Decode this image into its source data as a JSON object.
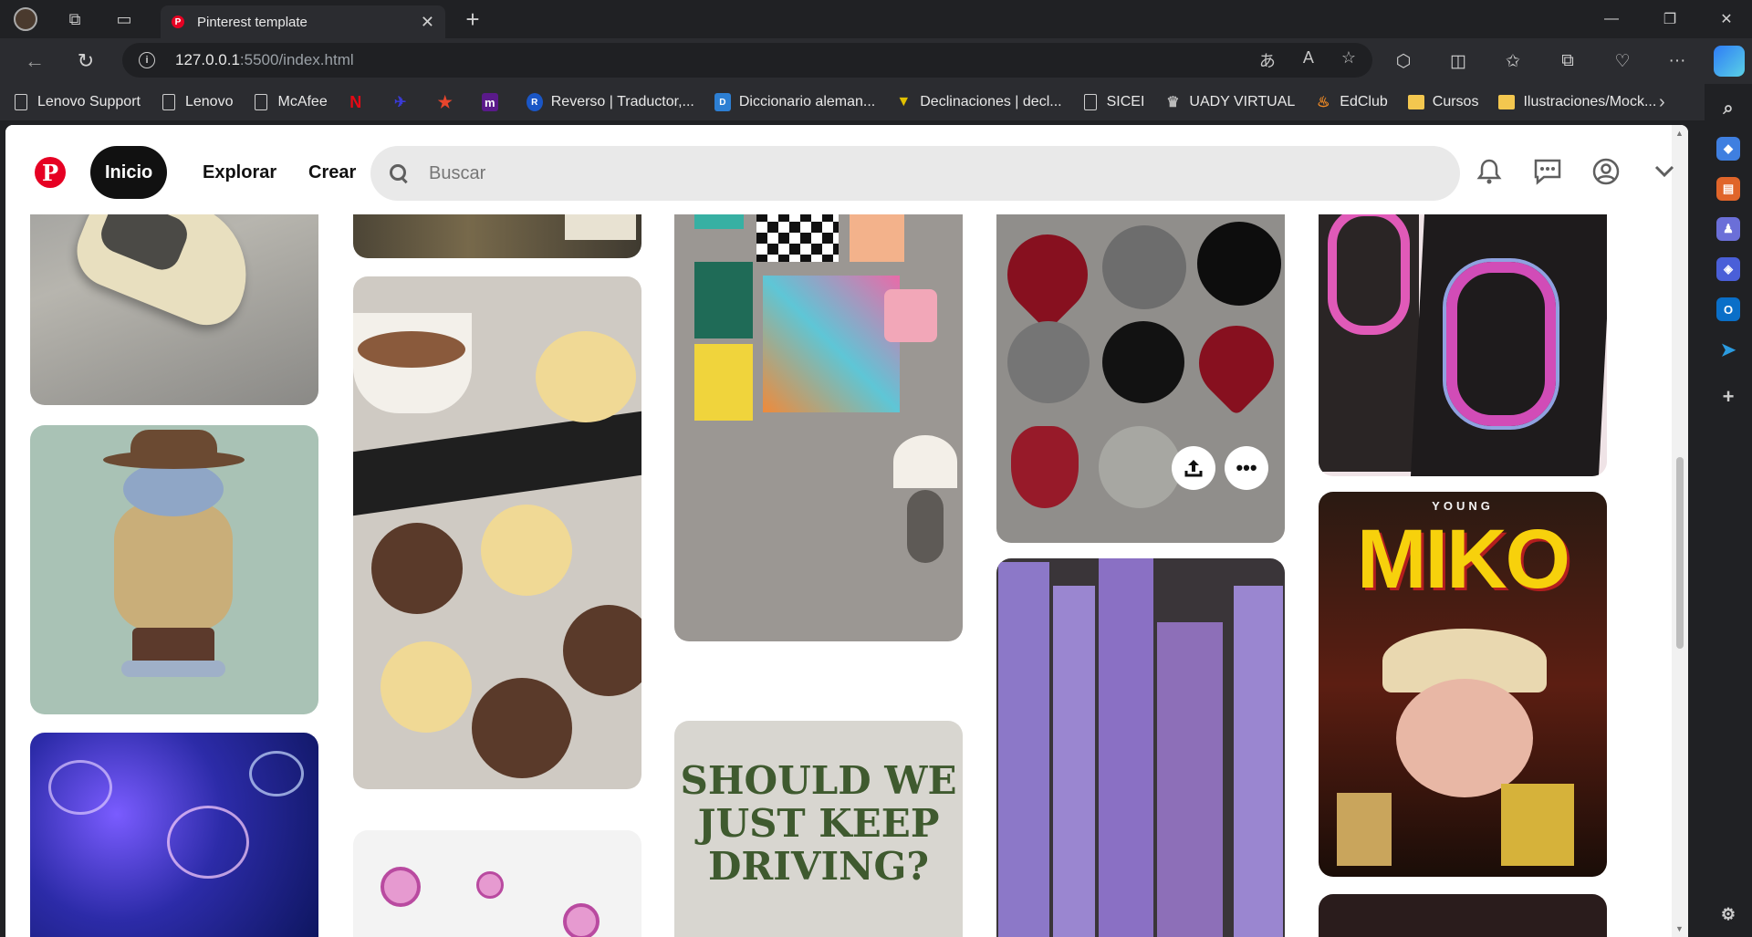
{
  "browser": {
    "tab_title": "Pinterest template",
    "url_host": "127.0.0.1",
    "url_rest": ":5500/index.html",
    "bookmarks": [
      {
        "label": "Lenovo Support",
        "icon": "doc-icon"
      },
      {
        "label": "Lenovo",
        "icon": "doc-icon"
      },
      {
        "label": "McAfee",
        "icon": "doc-icon"
      },
      {
        "label": "",
        "icon": "netflix-icon"
      },
      {
        "label": "",
        "icon": "bookmark-icon"
      },
      {
        "label": "",
        "icon": "star-bookmark-icon"
      },
      {
        "label": "",
        "icon": "m-icon"
      },
      {
        "label": "Reverso | Traductor,...",
        "icon": "reverso-icon"
      },
      {
        "label": "Diccionario aleman...",
        "icon": "dictionary-icon"
      },
      {
        "label": "Declinaciones | decl...",
        "icon": "declinaciones-icon"
      },
      {
        "label": "SICEI",
        "icon": "doc-icon"
      },
      {
        "label": "UADY VIRTUAL",
        "icon": "uady-icon"
      },
      {
        "label": "EdClub",
        "icon": "edclub-icon"
      },
      {
        "label": "Cursos",
        "icon": "folder-icon"
      },
      {
        "label": "Ilustraciones/Mock...",
        "icon": "folder-icon"
      }
    ]
  },
  "header": {
    "logo": "P",
    "nav": [
      "Inicio",
      "Explorar",
      "Crear"
    ],
    "search_placeholder": "Buscar"
  },
  "pins": {
    "poster_text": "SHOULD WE JUST KEEP DRIVING?",
    "miko_top": "YOUNG",
    "miko_title": "MIKO",
    "more_label": "•••",
    "share_label": "⇪"
  },
  "colors": {
    "pinterest_red": "#e60023",
    "active_pill": "#111111"
  }
}
